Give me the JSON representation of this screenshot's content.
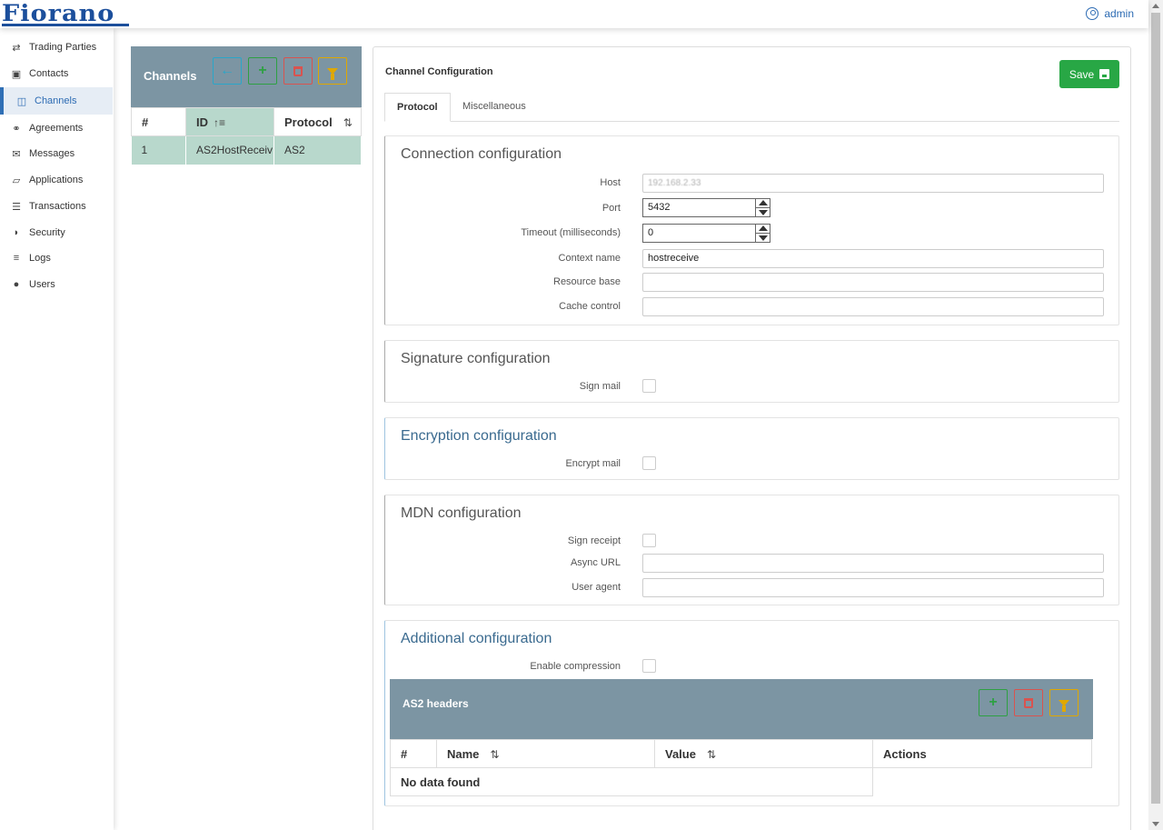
{
  "app": {
    "logo": "Fiorano",
    "user": "admin"
  },
  "sidebar": {
    "items": [
      {
        "label": "Trading Parties",
        "icon": "exchange-icon"
      },
      {
        "label": "Contacts",
        "icon": "contact-card-icon"
      },
      {
        "label": "Channels",
        "icon": "channels-icon",
        "active": true
      },
      {
        "label": "Agreements",
        "icon": "handshake-icon"
      },
      {
        "label": "Messages",
        "icon": "envelope-icon"
      },
      {
        "label": "Applications",
        "icon": "folder-open-icon"
      },
      {
        "label": "Transactions",
        "icon": "list-icon"
      },
      {
        "label": "Security",
        "icon": "shield-icon"
      },
      {
        "label": "Logs",
        "icon": "bars-icon"
      },
      {
        "label": "Users",
        "icon": "users-icon"
      }
    ]
  },
  "channels": {
    "title": "Channels",
    "columns": [
      "#",
      "ID",
      "Protocol"
    ],
    "rows": [
      {
        "index": "1",
        "id": "AS2HostReceiv",
        "protocol": "AS2"
      }
    ]
  },
  "config": {
    "title": "Channel Configuration",
    "save_label": "Save",
    "tabs": [
      "Protocol",
      "Miscellaneous"
    ],
    "active_tab": "Protocol",
    "connection": {
      "title": "Connection configuration",
      "host_label": "Host",
      "host_value": "192.168.2.33",
      "port_label": "Port",
      "port_value": "5432",
      "timeout_label": "Timeout (milliseconds)",
      "timeout_value": "0",
      "context_label": "Context name",
      "context_value": "hostreceive",
      "resource_label": "Resource base",
      "resource_value": "",
      "cache_label": "Cache control",
      "cache_value": ""
    },
    "signature": {
      "title": "Signature configuration",
      "sign_mail_label": "Sign mail",
      "sign_mail_checked": false
    },
    "encryption": {
      "title": "Encryption configuration",
      "encrypt_mail_label": "Encrypt mail",
      "encrypt_mail_checked": false
    },
    "mdn": {
      "title": "MDN configuration",
      "sign_receipt_label": "Sign receipt",
      "sign_receipt_checked": false,
      "async_url_label": "Async URL",
      "async_url_value": "",
      "user_agent_label": "User agent",
      "user_agent_value": ""
    },
    "additional": {
      "title": "Additional configuration",
      "compression_label": "Enable compression",
      "compression_checked": false,
      "as2_headers": {
        "title": "AS2 headers",
        "columns": [
          "#",
          "Name",
          "Value",
          "Actions"
        ],
        "empty_text": "No data found"
      }
    }
  },
  "colors": {
    "brand": "#1c4f9c",
    "accent": "#2c6bb3",
    "panel_header": "#7c95a3",
    "selected_row": "#b8d8cc",
    "save": "#28a745"
  }
}
